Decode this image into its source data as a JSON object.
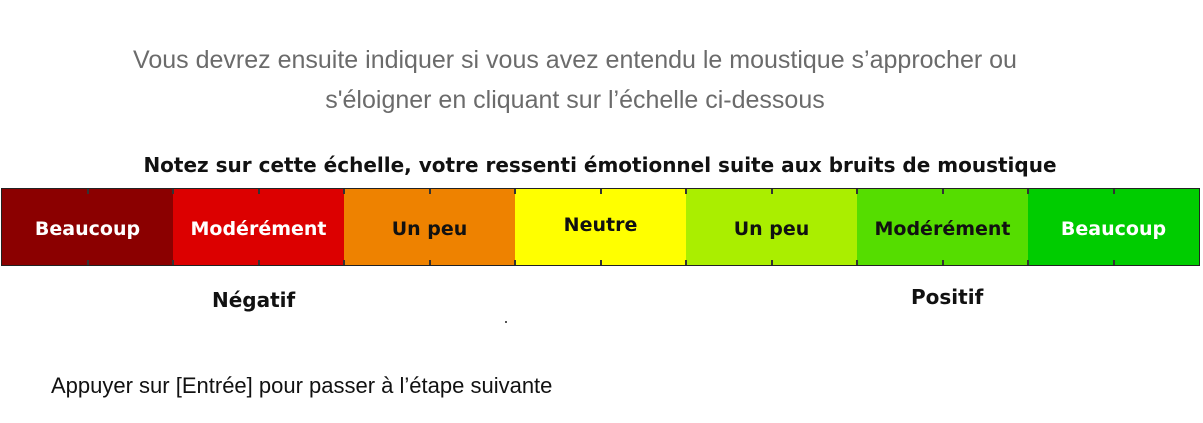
{
  "instruction": {
    "line1": "Vous devrez ensuite indiquer si vous avez entendu le moustique s’approcher ou",
    "line2": "s'éloigner en cliquant sur l’échelle ci-dessous"
  },
  "scale": {
    "title": "Notez sur cette échelle, votre ressenti émotionnel suite aux bruits de moustique",
    "segments": [
      {
        "label": "Beaucoup",
        "bg": "#8b0000",
        "fg": "#ffffff"
      },
      {
        "label": "Modérément",
        "bg": "#dc0000",
        "fg": "#ffffff"
      },
      {
        "label": "Un peu",
        "bg": "#ee8200",
        "fg": "#111111"
      },
      {
        "label": "Neutre",
        "bg": "#ffff00",
        "fg": "#111111"
      },
      {
        "label": "Un peu",
        "bg": "#aaee00",
        "fg": "#111111"
      },
      {
        "label": "Modérément",
        "bg": "#55dd00",
        "fg": "#111111"
      },
      {
        "label": "Beaucoup",
        "bg": "#00cc00",
        "fg": "#ffffff"
      }
    ],
    "negative_label": "Négatif",
    "positive_label": "Positif"
  },
  "footer": {
    "continue_text": "Appuyer sur [Entrée] pour passer à l’étape suivante"
  }
}
